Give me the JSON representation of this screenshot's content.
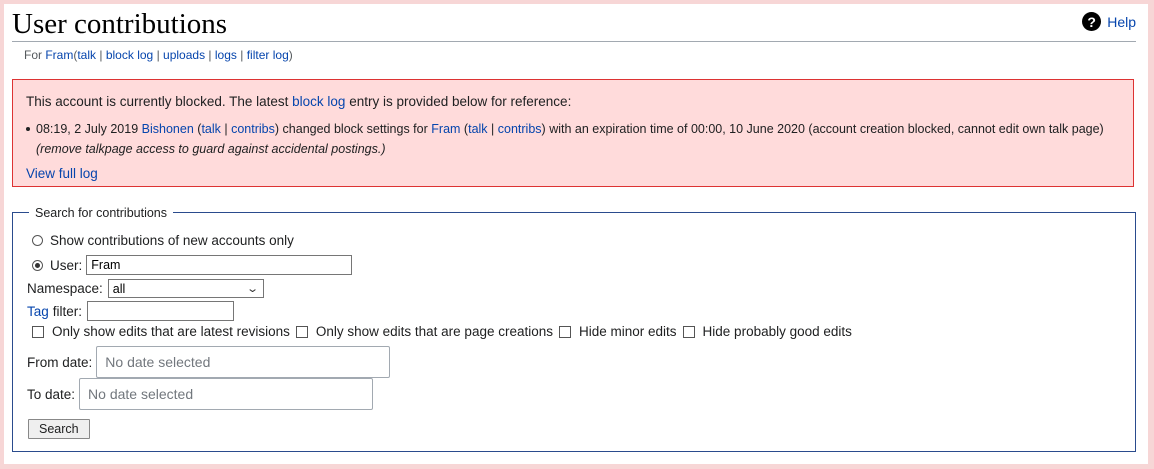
{
  "header": {
    "title": "User contributions",
    "help_label": "Help",
    "help_icon": "question-circle-icon"
  },
  "subtitle": {
    "prefix": "For",
    "user": "Fram",
    "open": "(",
    "talk": "talk",
    "block_log": "block log",
    "uploads": "uploads",
    "logs": "logs",
    "filter_log": "filter log",
    "close": ")",
    "sep": "|"
  },
  "block_notice": {
    "intro_before": "This account is currently blocked. The latest",
    "intro_link": "block log",
    "intro_after": "entry is provided below for reference:",
    "entry": {
      "timestamp": "08:19, 2 July 2019",
      "actor": "Bishonen",
      "actor_talk": "talk",
      "actor_contribs": "contribs",
      "action": "changed block settings for",
      "target": "Fram",
      "target_talk": "talk",
      "target_contribs": "contribs",
      "details": "with an expiration time of 00:00, 10 June 2020 (account creation blocked, cannot edit own talk page)",
      "comment": "(remove talkpage access to guard against accidental postings.)"
    },
    "view_full_log": "View full log"
  },
  "search_form": {
    "legend": "Search for contributions",
    "radio_new_accounts": "Show contributions of new accounts only",
    "radio_user": "User:",
    "user_value": "Fram",
    "namespace_label": "Namespace:",
    "namespace_value": "all",
    "tag_link": "Tag",
    "tag_label": "filter:",
    "tag_value": "",
    "checkboxes": [
      "Only show edits that are latest revisions",
      "Only show edits that are page creations",
      "Hide minor edits",
      "Hide probably good edits"
    ],
    "from_date_label": "From date:",
    "from_date_placeholder": "No date selected",
    "to_date_label": "To date:",
    "to_date_placeholder": "No date selected",
    "search_button": "Search"
  },
  "colors": {
    "link": "#0645ad",
    "notice_bg": "#ffdbdb",
    "notice_border": "#dd3333",
    "fieldset_border": "#2a4b8d"
  }
}
